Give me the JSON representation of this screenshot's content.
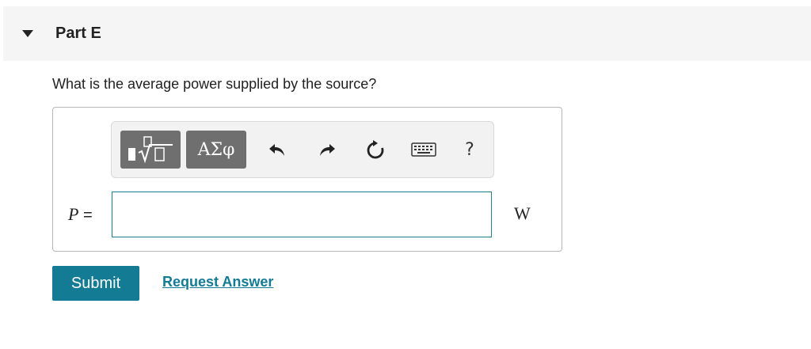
{
  "part": {
    "title": "Part E",
    "collapse_icon": "triangle-down-icon"
  },
  "question": {
    "text": "What is the average power supplied by the source?"
  },
  "toolbar": {
    "templates_icon": "templates-icon",
    "greek_label": "ΑΣφ",
    "undo_icon": "undo-icon",
    "redo_icon": "redo-icon",
    "reset_icon": "reset-icon",
    "keyboard_icon": "keyboard-icon",
    "help_label": "?"
  },
  "answer": {
    "variable": "P",
    "equals": "=",
    "value": "",
    "unit": "W"
  },
  "actions": {
    "submit_label": "Submit",
    "request_answer_label": "Request Answer"
  },
  "colors": {
    "accent": "#137b94",
    "input_border": "#1e7f8a",
    "toolbar_button": "#6f6f6f"
  }
}
